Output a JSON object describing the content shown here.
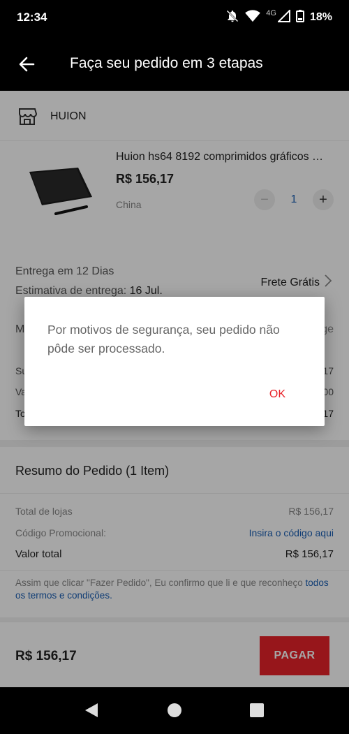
{
  "status_bar": {
    "time": "12:34",
    "network": "4G",
    "battery": "18%"
  },
  "app_bar": {
    "title": "Faça seu pedido em 3 etapas"
  },
  "store": {
    "name": "HUION"
  },
  "product": {
    "name": "Huion hs64 8192 comprimidos gráficos …",
    "price": "R$ 156,17",
    "origin": "China",
    "quantity": "1",
    "minus": "−",
    "plus": "+"
  },
  "delivery": {
    "line1": "Entrega em 12 Dias",
    "line2_label": "Estimativa de entrega:",
    "line2_date": "16 Jul.",
    "shipping": "Frete Grátis"
  },
  "obscured": {
    "m": "M",
    "ge": "ge",
    "su": "Su",
    "va": "Va",
    "to": "To",
    "v17a": "17",
    "v00": "00",
    "v17b": "17"
  },
  "summary": {
    "title": "Resumo do Pedido (1 Item)",
    "rows": [
      {
        "label": "Total de lojas",
        "value": "R$ 156,17"
      },
      {
        "label": "Código Promocional:",
        "value": "Insira o código aqui"
      },
      {
        "label": "Valor total",
        "value": "R$ 156,17"
      }
    ],
    "terms_text": "Assim que clicar \"Fazer Pedido\", Eu confirmo que li e que reconheço ",
    "terms_link": "todos os termos e condições."
  },
  "bottom_bar": {
    "total": "R$ 156,17",
    "pay_label": "PAGAR"
  },
  "dialog": {
    "message": "Por motivos de segurança, seu pedido não pôde ser processado.",
    "ok_label": "OK"
  },
  "colors": {
    "accent": "#e8232a",
    "link": "#1a5fb4",
    "header": "#000000"
  }
}
